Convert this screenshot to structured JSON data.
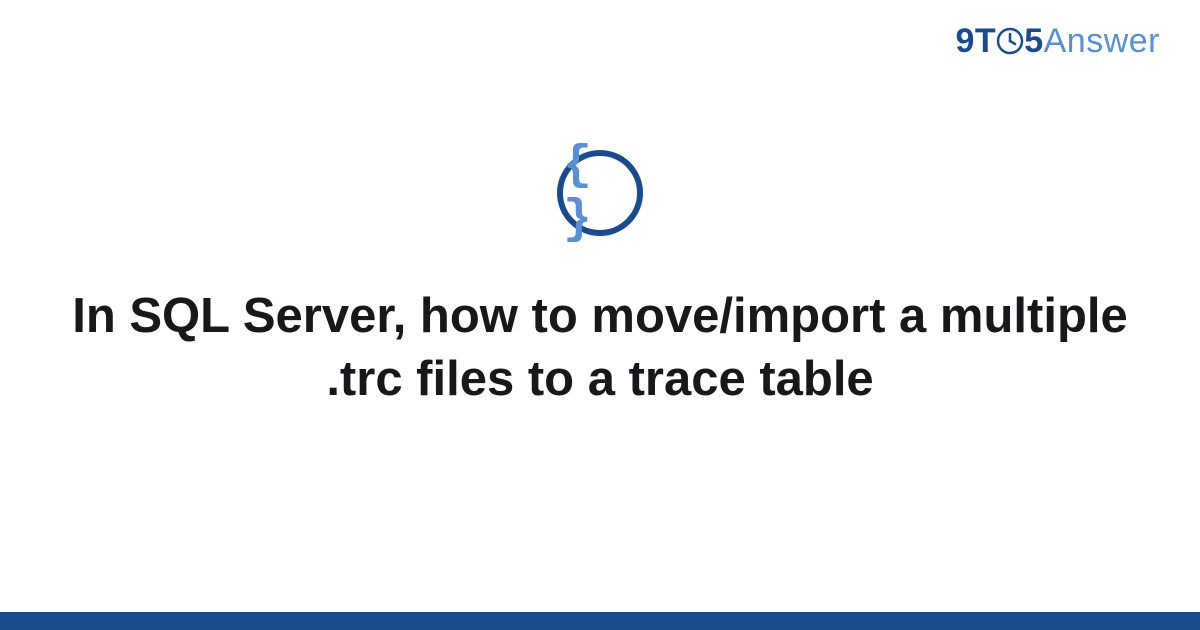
{
  "logo": {
    "part_9": "9",
    "part_t": "T",
    "part_5": "5",
    "part_answer": "Answer"
  },
  "icon": {
    "name": "code-braces-icon",
    "glyph": "{ }"
  },
  "title": "In SQL Server, how to move/import a multiple .trc files to a trace table",
  "colors": {
    "primary": "#1a4b8c",
    "secondary": "#5a8fd4"
  }
}
